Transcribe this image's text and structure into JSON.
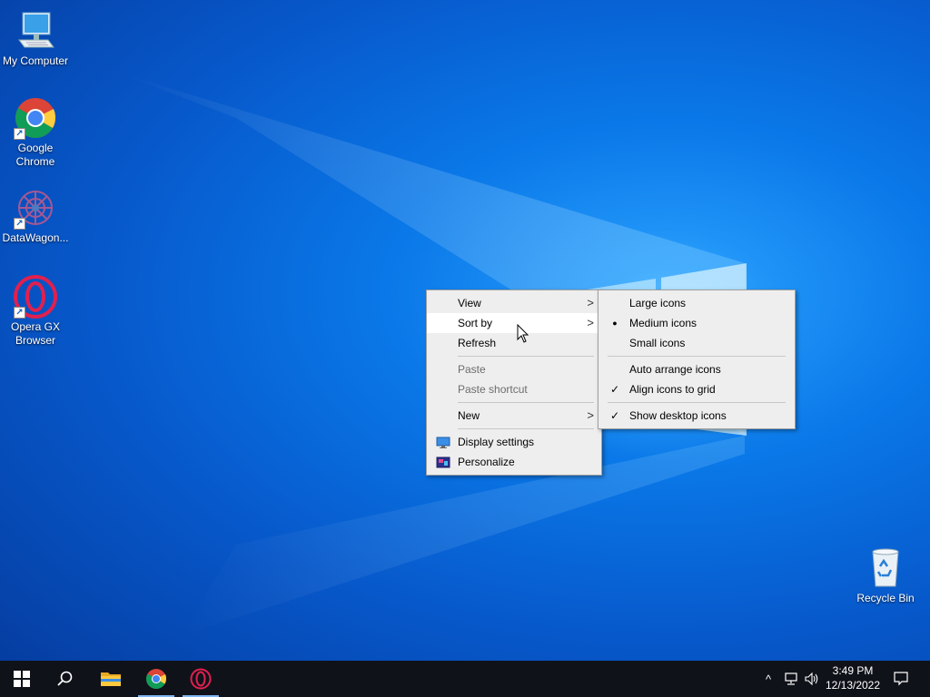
{
  "desktop": {
    "icons": [
      {
        "label": "My Computer",
        "icon": "computer-icon"
      },
      {
        "label": "Google Chrome",
        "icon": "chrome-icon"
      },
      {
        "label": "DataWagon...",
        "icon": "datawagon-icon"
      },
      {
        "label": "Opera GX Browser",
        "icon": "opera-gx-icon"
      },
      {
        "label": "Recycle Bin",
        "icon": "recycle-bin-icon"
      }
    ]
  },
  "context_menu": {
    "items": [
      {
        "label": "View",
        "submenu": true
      },
      {
        "label": "Sort by",
        "submenu": true,
        "highlighted": true
      },
      {
        "label": "Refresh"
      },
      {
        "label": "Paste",
        "disabled": true
      },
      {
        "label": "Paste shortcut",
        "disabled": true
      },
      {
        "label": "New",
        "submenu": true
      },
      {
        "label": "Display settings",
        "icon": "display-settings-icon"
      },
      {
        "label": "Personalize",
        "icon": "personalize-icon"
      }
    ]
  },
  "view_submenu": {
    "items": [
      {
        "label": "Large icons",
        "mark": ""
      },
      {
        "label": "Medium icons",
        "mark": "●"
      },
      {
        "label": "Small icons",
        "mark": ""
      },
      {
        "label": "Auto arrange icons",
        "mark": ""
      },
      {
        "label": "Align icons to grid",
        "mark": "✓"
      },
      {
        "label": "Show desktop icons",
        "mark": "✓"
      }
    ]
  },
  "taskbar": {
    "pinned": [
      "start-icon",
      "search-icon",
      "file-explorer-icon",
      "chrome-icon",
      "opera-gx-icon"
    ],
    "clock": {
      "time": "3:49 PM",
      "date": "12/13/2022"
    }
  },
  "colors": {
    "accent": "#0a78e8",
    "taskbar": "#10121a",
    "menu_bg": "#eeeeee"
  }
}
